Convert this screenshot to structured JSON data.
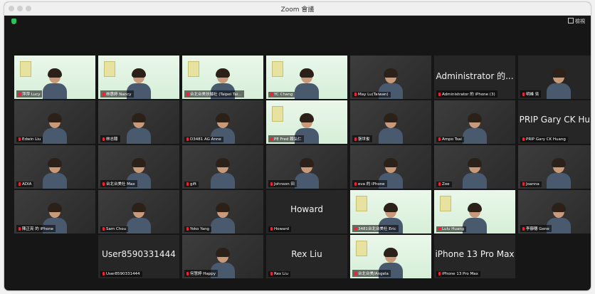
{
  "window": {
    "title": "Zoom 會議",
    "view_label": "檢視"
  },
  "tiles": [
    {
      "label": "萍萍 Lucy",
      "style": "green",
      "big": ""
    },
    {
      "label": "林惠婷 Nancy",
      "style": "green",
      "big": ""
    },
    {
      "label": "台北台美扶輪社 (Taipei Tai...",
      "style": "green",
      "big": ""
    },
    {
      "label": "YC Chang",
      "style": "green",
      "big": ""
    },
    {
      "label": "May Lu(Taiwan)",
      "style": "photo",
      "big": ""
    },
    {
      "label": "Administrator 的 iPhone (3)",
      "style": "dark",
      "big": "Administrator 的..."
    },
    {
      "label": "明峰 吳",
      "style": "dark",
      "big": ""
    },
    {
      "label": "Edwin Liu",
      "style": "photo",
      "big": ""
    },
    {
      "label": "林志聰",
      "style": "photo",
      "big": ""
    },
    {
      "label": "D3481 AG Anne",
      "style": "photo",
      "big": ""
    },
    {
      "label": "PE Fred 賴弘仁",
      "style": "green",
      "big": ""
    },
    {
      "label": "張世俊",
      "style": "photo",
      "big": ""
    },
    {
      "label": "Ampo Tsai",
      "style": "photo",
      "big": ""
    },
    {
      "label": "PRIP Gary CK Huang",
      "style": "dark",
      "big": "PRIP Gary CK Hu..."
    },
    {
      "label": "ADIA",
      "style": "photo",
      "big": ""
    },
    {
      "label": "台北台美社 Max",
      "style": "photo",
      "big": ""
    },
    {
      "label": "gift",
      "style": "photo",
      "big": ""
    },
    {
      "label": "Johnson 田",
      "style": "photo",
      "big": ""
    },
    {
      "label": "eva 的 iPhone",
      "style": "photo",
      "big": ""
    },
    {
      "label": "Zoe",
      "style": "photo",
      "big": ""
    },
    {
      "label": "Joanna",
      "style": "photo",
      "big": ""
    },
    {
      "label": "陳正亮 的 iPhone",
      "style": "photo",
      "big": ""
    },
    {
      "label": "Sam Chou",
      "style": "photo",
      "big": ""
    },
    {
      "label": "Yoko Yang",
      "style": "photo",
      "big": ""
    },
    {
      "label": "Howard",
      "style": "dark",
      "big": "Howard"
    },
    {
      "label": "3481台北台美社 Eric",
      "style": "green",
      "big": ""
    },
    {
      "label": "Lulu Huang",
      "style": "green",
      "big": ""
    },
    {
      "label": "李靜穗 Gene",
      "style": "photo",
      "big": ""
    },
    {
      "label": "User8590331444",
      "style": "dark",
      "big": "User8590331444"
    },
    {
      "label": "何慧婷 Happy",
      "style": "photo",
      "big": ""
    },
    {
      "label": "Rex Liu",
      "style": "dark",
      "big": "Rex Liu"
    },
    {
      "label": "台北台美/Angela",
      "style": "green",
      "big": ""
    },
    {
      "label": "iPhone 13 Pro Max",
      "style": "dark",
      "big": "iPhone 13 Pro Max"
    }
  ]
}
